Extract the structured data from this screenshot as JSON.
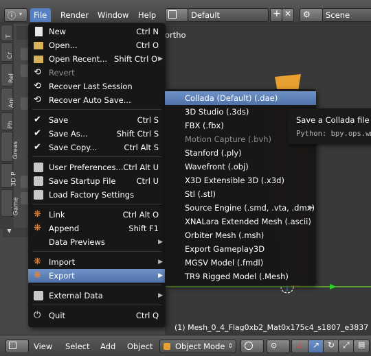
{
  "topbar": {
    "info_label": "ⓘ",
    "menus": [
      "File",
      "Render",
      "Window",
      "Help"
    ],
    "screen_layout": "Default",
    "scene": "Scene"
  },
  "left_tabs": [
    "T",
    "Cr",
    "Rel",
    "Ani",
    "Ph",
    "Greas",
    "3D P",
    "Game"
  ],
  "viewport": {
    "view_label": "ortho",
    "status_text": "(1) Mesh_0_4_Flag0xb2_Mat0x175c4_s1807_e3837"
  },
  "file_menu": {
    "items": [
      {
        "label": "New",
        "shortcut": "Ctrl N",
        "icon": "new-file-icon"
      },
      {
        "label": "Open...",
        "shortcut": "Ctrl O",
        "icon": "folder-icon"
      },
      {
        "label": "Open Recent...",
        "shortcut": "Shift Ctrl O",
        "icon": "folder-icon",
        "submenu": true
      },
      {
        "label": "Revert",
        "shortcut": "",
        "icon": "revert-icon",
        "disabled": true
      },
      {
        "label": "Recover Last Session",
        "shortcut": "",
        "icon": "recover-icon"
      },
      {
        "label": "Recover Auto Save...",
        "shortcut": "",
        "icon": "recover-icon"
      },
      {
        "label": "Save",
        "shortcut": "Ctrl S",
        "icon": "checkmark-icon"
      },
      {
        "label": "Save As...",
        "shortcut": "Shift Ctrl S",
        "icon": "save-as-icon"
      },
      {
        "label": "Save Copy...",
        "shortcut": "Ctrl Alt S",
        "icon": "save-copy-icon"
      },
      {
        "label": "User Preferences...",
        "shortcut": "Ctrl Alt U",
        "icon": "preferences-icon"
      },
      {
        "label": "Save Startup File",
        "shortcut": "Ctrl U",
        "icon": "save-icon"
      },
      {
        "label": "Load Factory Settings",
        "shortcut": "",
        "icon": "load-icon"
      },
      {
        "label": "Link",
        "shortcut": "Ctrl Alt O",
        "icon": "link-icon"
      },
      {
        "label": "Append",
        "shortcut": "Shift F1",
        "icon": "append-icon"
      },
      {
        "label": "Data Previews",
        "shortcut": "",
        "icon": "",
        "submenu": true
      },
      {
        "label": "Import",
        "shortcut": "",
        "icon": "import-icon",
        "submenu": true
      },
      {
        "label": "Export",
        "shortcut": "",
        "icon": "export-icon",
        "submenu": true,
        "highlighted": true
      },
      {
        "label": "External Data",
        "shortcut": "",
        "icon": "external-data-icon",
        "submenu": true
      },
      {
        "label": "Quit",
        "shortcut": "Ctrl Q",
        "icon": "quit-icon"
      }
    ]
  },
  "export_menu": {
    "items": [
      {
        "label": "Collada (Default) (.dae)",
        "highlighted": true
      },
      {
        "label": "3D Studio (.3ds)"
      },
      {
        "label": "FBX (.fbx)"
      },
      {
        "label": "Motion Capture (.bvh)",
        "disabled": true
      },
      {
        "label": "Stanford (.ply)"
      },
      {
        "label": "Wavefront (.obj)"
      },
      {
        "label": "X3D Extensible 3D (.x3d)"
      },
      {
        "label": "Stl (.stl)"
      },
      {
        "label": "Source Engine (.smd, .vta, .dmx)",
        "submenu": true
      },
      {
        "label": "XNALara Extended Mesh (.ascii)"
      },
      {
        "label": "Orbiter Mesh (.msh)"
      },
      {
        "label": "Export Gameplay3D"
      },
      {
        "label": "MGSV Model (.fmdl)"
      },
      {
        "label": "TR9 Rigged Model (.Mesh)"
      }
    ]
  },
  "tooltip": {
    "title": "Save a Collada file",
    "python": "Python: bpy.ops.wm"
  },
  "bottombar": {
    "menus": [
      "View",
      "Select",
      "Add",
      "Object"
    ],
    "mode": "Object Mode"
  },
  "colors": {
    "highlight": "#5680c2",
    "menu_bg": "#161616",
    "mesh": "#e08a1e"
  }
}
